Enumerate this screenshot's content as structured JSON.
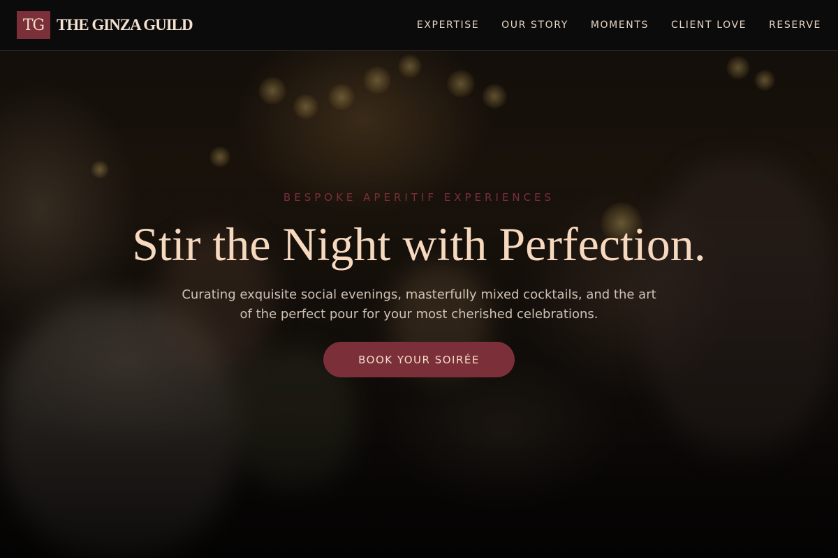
{
  "header": {
    "logo_mark": "TG",
    "logo_text": "THE GINZA GUILD",
    "nav": [
      {
        "label": "EXPERTISE"
      },
      {
        "label": "OUR STORY"
      },
      {
        "label": "MOMENTS"
      },
      {
        "label": "CLIENT LOVE"
      },
      {
        "label": "RESERVE"
      }
    ]
  },
  "hero": {
    "eyebrow": "BESPOKE APERITIF EXPERIENCES",
    "headline": "Stir the Night with Perfection.",
    "subhead": "Curating exquisite social evenings, masterfully mixed cocktails, and the art of the perfect pour for your most cherished celebrations.",
    "cta_label": "BOOK YOUR SOIRÉE",
    "background_image": "blurred-celebration-toast-photo"
  },
  "colors": {
    "accent": "#7a2f39",
    "headline": "#f6d9bf",
    "nav_text": "#e8d5c2",
    "header_bg": "#0c0b0b"
  }
}
